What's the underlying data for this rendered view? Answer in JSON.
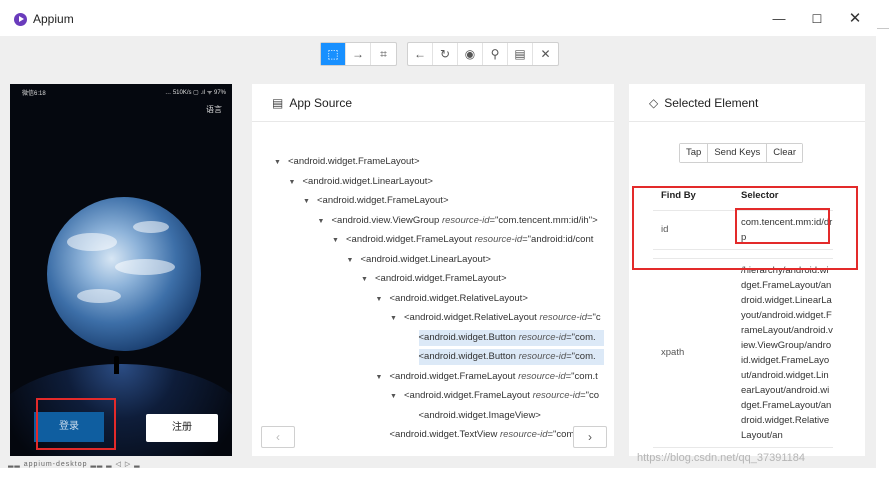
{
  "window": {
    "title": "Appium",
    "min_glyph": "—",
    "max_glyph": "☐",
    "close_glyph": "✕"
  },
  "toolbar": {
    "group1": [
      {
        "icon": "select-element-icon",
        "glyph": "⬚",
        "active": true
      },
      {
        "icon": "swipe-arrow-icon",
        "glyph": "→",
        "active": false
      },
      {
        "icon": "tap-coordinates-icon",
        "glyph": "⌗",
        "active": false
      }
    ],
    "group2": [
      {
        "icon": "back-arrow-icon",
        "glyph": "←"
      },
      {
        "icon": "refresh-icon",
        "glyph": "↻"
      },
      {
        "icon": "eye-icon",
        "glyph": "◉"
      },
      {
        "icon": "search-icon",
        "glyph": "⚲"
      },
      {
        "icon": "copy-xml-icon",
        "glyph": "▤"
      },
      {
        "icon": "close-icon",
        "glyph": "✕"
      }
    ]
  },
  "device": {
    "status_left": "微信6:18",
    "status_right": "… 510K/s ▢ .ıl ᯤ 97%",
    "language_link": "语言",
    "login_label": "登录",
    "register_label": "注册"
  },
  "app_source": {
    "title": "App Source",
    "nodes": [
      {
        "tag": "<android.widget.FrameLayout>",
        "attr": "",
        "value": "",
        "caret": true
      },
      {
        "tag": "<android.widget.LinearLayout>",
        "attr": "",
        "value": "",
        "caret": true
      },
      {
        "tag": "<android.widget.FrameLayout>",
        "attr": "",
        "value": "",
        "caret": true
      },
      {
        "tag": "<android.view.ViewGroup ",
        "attr": "resource-id",
        "value": "=\"com.tencent.mm:id/ih\">",
        "caret": true
      },
      {
        "tag": "<android.widget.FrameLayout ",
        "attr": "resource-id",
        "value": "=\"android:id/cont",
        "caret": true
      },
      {
        "tag": "<android.widget.LinearLayout>",
        "attr": "",
        "value": "",
        "caret": true
      },
      {
        "tag": "<android.widget.FrameLayout>",
        "attr": "",
        "value": "",
        "caret": true
      },
      {
        "tag": "<android.widget.RelativeLayout>",
        "attr": "",
        "value": "",
        "caret": true
      },
      {
        "tag": "<android.widget.RelativeLayout ",
        "attr": "resource-id",
        "value": "=\"c",
        "caret": true
      },
      {
        "tag": "<android.widget.Button ",
        "attr": "resource-id",
        "value": "=\"com.",
        "caret": false,
        "selected": true
      },
      {
        "tag": "<android.widget.Button ",
        "attr": "resource-id",
        "value": "=\"com.",
        "caret": false,
        "selected": true
      },
      {
        "tag": "<android.widget.FrameLayout ",
        "attr": "resource-id",
        "value": "=\"com.t",
        "caret": true
      },
      {
        "tag": "<android.widget.FrameLayout ",
        "attr": "resource-id",
        "value": "=\"co",
        "caret": true
      },
      {
        "tag": "<android.widget.ImageView>",
        "attr": "",
        "value": "",
        "caret": false
      },
      {
        "tag": "<android.widget.TextView ",
        "attr": "resource-id",
        "value": "=\"com.tenc",
        "caret": false
      }
    ],
    "prev_glyph": "‹",
    "next_glyph": "›"
  },
  "selected_element": {
    "title": "Selected Element",
    "actions": [
      "Tap",
      "Send Keys",
      "Clear"
    ],
    "headers": {
      "find_by": "Find By",
      "selector": "Selector"
    },
    "rows": [
      {
        "key": "id",
        "value": "com.tencent.mm:id/drp"
      },
      {
        "key": "",
        "value": ""
      },
      {
        "key": "xpath",
        "value": "/hierarchy/android.widget.FrameLayout/android.widget.LinearLayout/android.widget.FrameLayout/android.view.ViewGroup/android.widget.FrameLayout/android.widget.LinearLayout/android.widget.FrameLayout/android.widget.RelativeLayout/an"
      }
    ]
  },
  "watermark": "https://blog.csdn.net/qq_37391184",
  "bottom_strip": "▂▂ appium-desktop ▂▂ ▂ ◁ ▷ ▂"
}
